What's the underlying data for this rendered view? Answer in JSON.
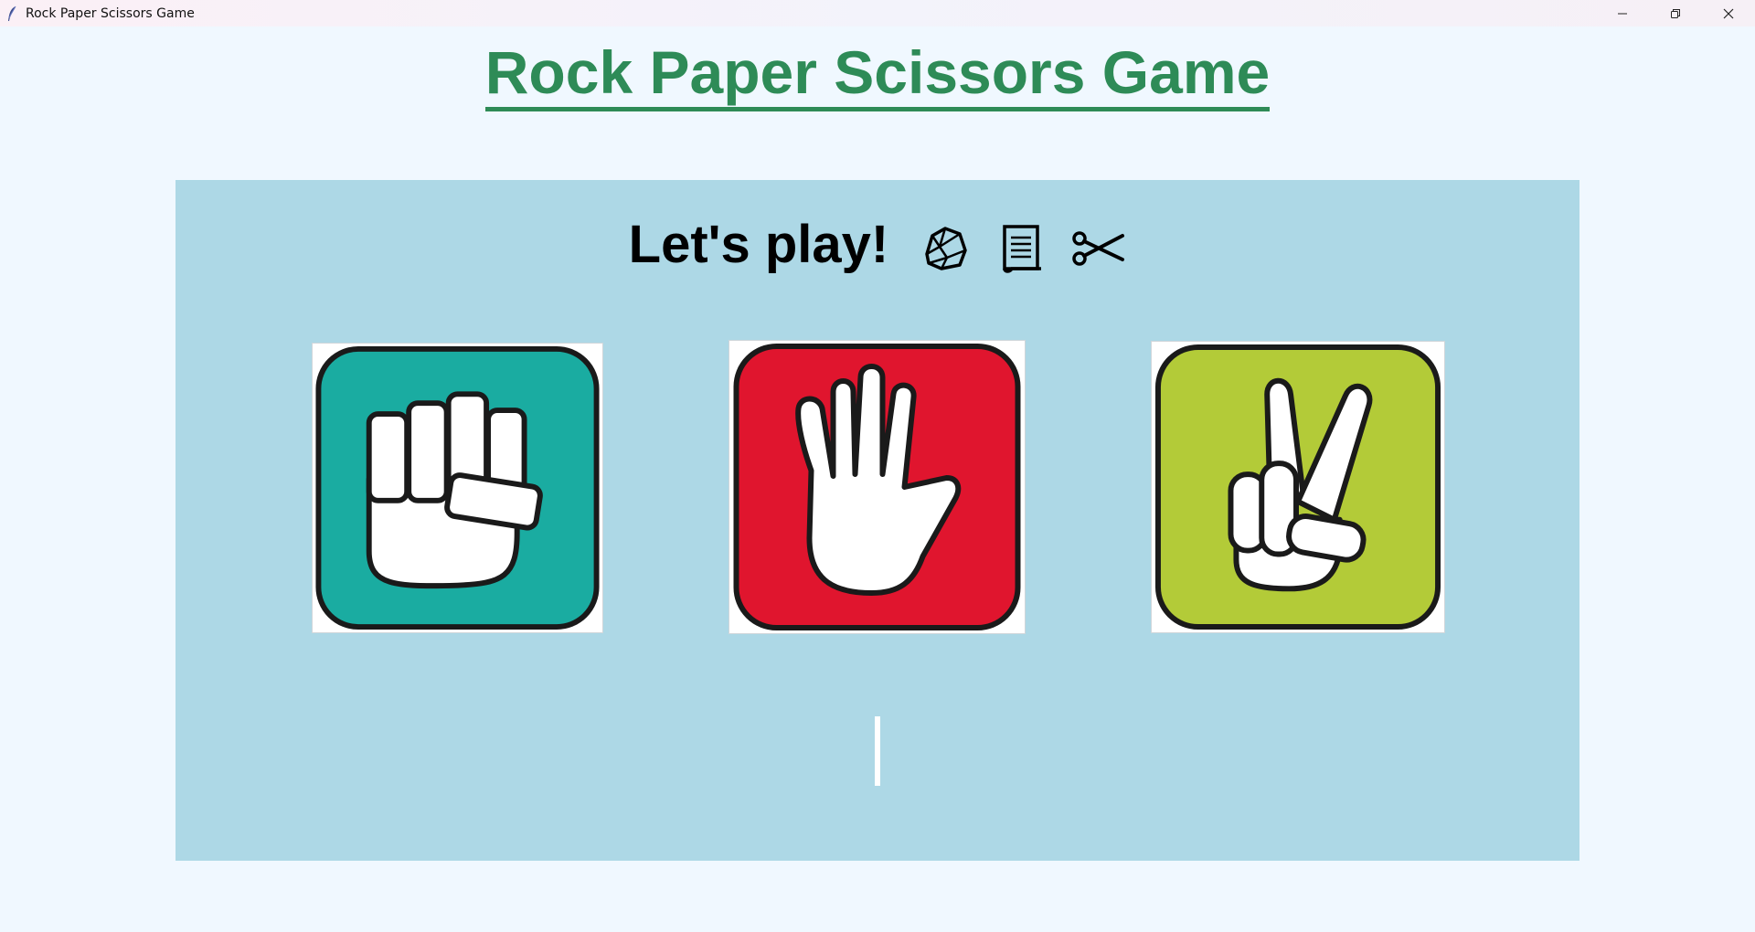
{
  "window": {
    "title": "Rock Paper Scissors Game"
  },
  "header": {
    "title": "Rock Paper Scissors Game",
    "color": "#2e8b57"
  },
  "game": {
    "prompt": "Let's play!",
    "prompt_icons": [
      "rock-icon",
      "scroll-icon",
      "scissors-icon"
    ],
    "panel_color": "#add8e6",
    "choices": [
      {
        "name": "rock",
        "icon": "fist-hand-icon",
        "color": "#1aaca1"
      },
      {
        "name": "paper",
        "icon": "open-hand-icon",
        "color": "#e0152e"
      },
      {
        "name": "scissors",
        "icon": "peace-hand-icon",
        "color": "#b3cb38"
      }
    ],
    "result": ""
  }
}
